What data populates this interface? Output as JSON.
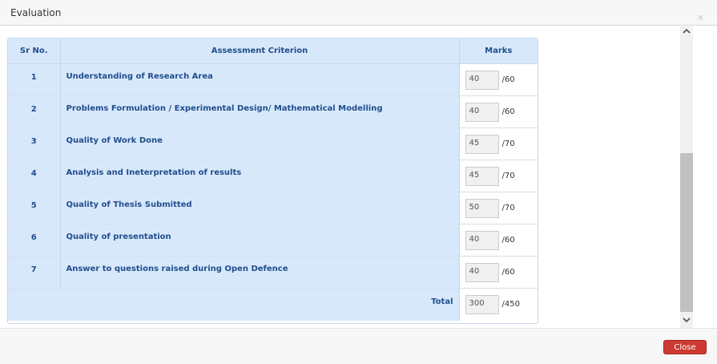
{
  "dialog": {
    "title": "Evaluation",
    "close_x": "×",
    "close_button_label": "Close"
  },
  "table": {
    "headers": {
      "sr_no": "Sr No.",
      "criterion": "Assessment Criterion",
      "marks": "Marks"
    },
    "rows": [
      {
        "sr": "1",
        "criterion": "Understanding of Research Area",
        "value": "40",
        "max": "/60"
      },
      {
        "sr": "2",
        "criterion": "Problems Formulation / Experimental Design/ Mathematical Modelling",
        "value": "40",
        "max": "/60"
      },
      {
        "sr": "3",
        "criterion": "Quality of Work Done",
        "value": "45",
        "max": "/70"
      },
      {
        "sr": "4",
        "criterion": "Analysis and Ineterpretation of results",
        "value": "45",
        "max": "/70"
      },
      {
        "sr": "5",
        "criterion": "Quality of Thesis Submitted",
        "value": "50",
        "max": "/70"
      },
      {
        "sr": "6",
        "criterion": "Quality of presentation",
        "value": "40",
        "max": "/60"
      },
      {
        "sr": "7",
        "criterion": "Answer to questions raised during Open Defence",
        "value": "40",
        "max": "/60"
      }
    ],
    "total": {
      "label": "Total",
      "value": "300",
      "max": "/450"
    }
  },
  "scrollbar": {
    "up_icon": "chevron-up-icon",
    "down_icon": "chevron-down-icon"
  },
  "colors": {
    "header_bg": "#d8e8fb",
    "header_text": "#1f4e8c",
    "close_button": "#cc3a32"
  }
}
